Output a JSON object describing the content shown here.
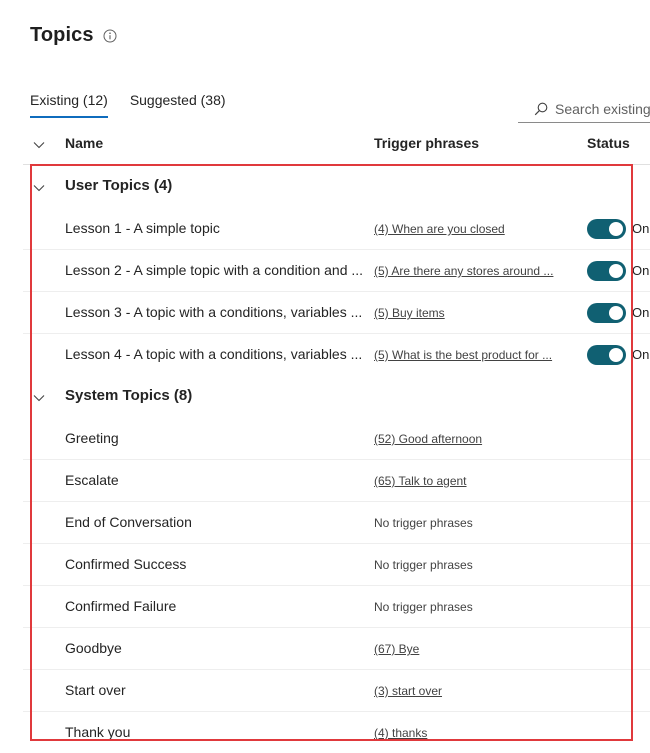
{
  "page": {
    "title": "Topics",
    "info_icon": "info-icon"
  },
  "tabs": [
    {
      "label": "Existing (12)",
      "active": true
    },
    {
      "label": "Suggested (38)",
      "active": false
    }
  ],
  "search": {
    "placeholder": "Search existing",
    "icon": "search-icon"
  },
  "table": {
    "columns": {
      "name": "Name",
      "trigger": "Trigger phrases",
      "status": "Status"
    },
    "toggle_color": "#106072",
    "groups": [
      {
        "label": "User Topics (4)",
        "rows": [
          {
            "name": "Lesson 1 - A simple topic",
            "trigger": "(4) When are you closed",
            "status": "On"
          },
          {
            "name": "Lesson 2 - A simple topic with a condition and ...",
            "trigger": "(5) Are there any stores around ...",
            "status": "On"
          },
          {
            "name": "Lesson 3 - A topic with a conditions, variables ...",
            "trigger": "(5) Buy items",
            "status": "On"
          },
          {
            "name": "Lesson 4 - A topic with a conditions, variables ...",
            "trigger": "(5) What is the best product for ...",
            "status": "On"
          }
        ]
      },
      {
        "label": "System Topics (8)",
        "rows": [
          {
            "name": "Greeting",
            "trigger": "(52) Good afternoon"
          },
          {
            "name": "Escalate",
            "trigger": "(65) Talk to agent"
          },
          {
            "name": "End of Conversation",
            "trigger": "No trigger phrases"
          },
          {
            "name": "Confirmed Success",
            "trigger": "No trigger phrases"
          },
          {
            "name": "Confirmed Failure",
            "trigger": "No trigger phrases"
          },
          {
            "name": "Goodbye",
            "trigger": "(67) Bye"
          },
          {
            "name": "Start over",
            "trigger": "(3) start over"
          },
          {
            "name": "Thank you",
            "trigger": "(4) thanks"
          }
        ]
      }
    ]
  },
  "annotation": {
    "highlight_color": "#e0393c"
  }
}
